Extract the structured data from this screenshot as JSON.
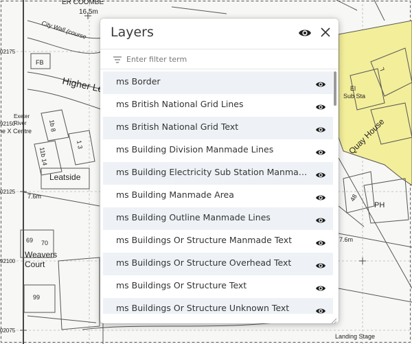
{
  "map": {
    "labels": {
      "coombe": "ER COOMBE",
      "height_top": "16.5m",
      "city_wall": "City Wall (course",
      "fb": "FB",
      "higher_le": "Higher Le",
      "exeter": "Exeter",
      "river": "River",
      "x_centre": "he X Centre",
      "no_1b8": "1b 8",
      "no_11b14": "11b 14",
      "no_13": "1 3",
      "leatside": "Leatside",
      "height_mid": "7.6m",
      "no_69": "69",
      "no_70": "70",
      "weavers": "Weavers",
      "court": "Court",
      "no_99": "99",
      "el": "El",
      "sub_sta": "Sub Sta",
      "quay_house": "Quay House",
      "no_48": "48",
      "ph": "PH",
      "height_right": "7.6m",
      "landing_stage": "Landing Stage",
      "l": "L"
    },
    "ticks": {
      "t1": "02175",
      "t2": "92150",
      "t3": "02125",
      "t4": "92100",
      "t5": "02075"
    },
    "colors": {
      "building_fill": "#f3ee9a"
    }
  },
  "panel": {
    "title": "Layers",
    "header_eye_icon": "eye-icon",
    "close_icon": "close-icon",
    "filter": {
      "placeholder": "Enter filter term",
      "value": "",
      "icon": "filter-icon"
    }
  },
  "layers": [
    {
      "label": "ms Border",
      "visible": true
    },
    {
      "label": "ms British National Grid Lines",
      "visible": true
    },
    {
      "label": "ms British National Grid Text",
      "visible": true
    },
    {
      "label": "ms Building Division Manmade Lines",
      "visible": true
    },
    {
      "label": "ms Building Electricity Sub Station Manmade Area",
      "visible": true
    },
    {
      "label": "ms Building Manmade Area",
      "visible": true
    },
    {
      "label": "ms Building Outline Manmade Lines",
      "visible": true
    },
    {
      "label": "ms Buildings Or Structure Manmade Text",
      "visible": true
    },
    {
      "label": "ms Buildings Or Structure Overhead Text",
      "visible": true
    },
    {
      "label": "ms Buildings Or Structure Text",
      "visible": true
    },
    {
      "label": "ms Buildings Or Structure Unknown Text",
      "visible": true
    }
  ]
}
